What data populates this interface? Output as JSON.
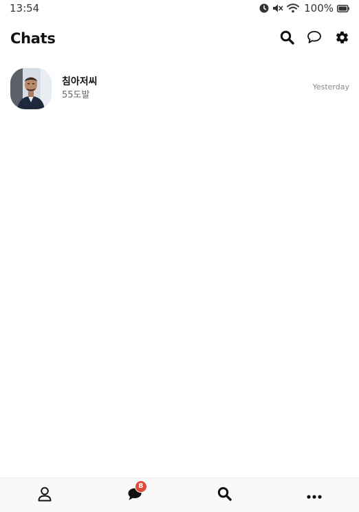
{
  "status_bar": {
    "time": "13:54",
    "battery": "100%",
    "icons": [
      "alarm-icon",
      "mute-icon",
      "wifi-icon",
      "battery-icon"
    ]
  },
  "header": {
    "title": "Chats",
    "actions": [
      "search-icon",
      "new-chat-icon",
      "settings-icon"
    ]
  },
  "chats": [
    {
      "name": "침아저씨",
      "preview": "55도발",
      "time": "Yesterday",
      "avatar": "profile-photo"
    }
  ],
  "tab_bar": {
    "tabs": [
      {
        "icon": "friends-icon"
      },
      {
        "icon": "chats-icon",
        "badge": "8",
        "active": true
      },
      {
        "icon": "search-icon"
      },
      {
        "icon": "more-icon"
      }
    ]
  },
  "colors": {
    "badge": "#e04a3a",
    "text_primary": "#111111",
    "text_secondary": "#666666",
    "tab_bar_bg": "#f9f9f9"
  }
}
